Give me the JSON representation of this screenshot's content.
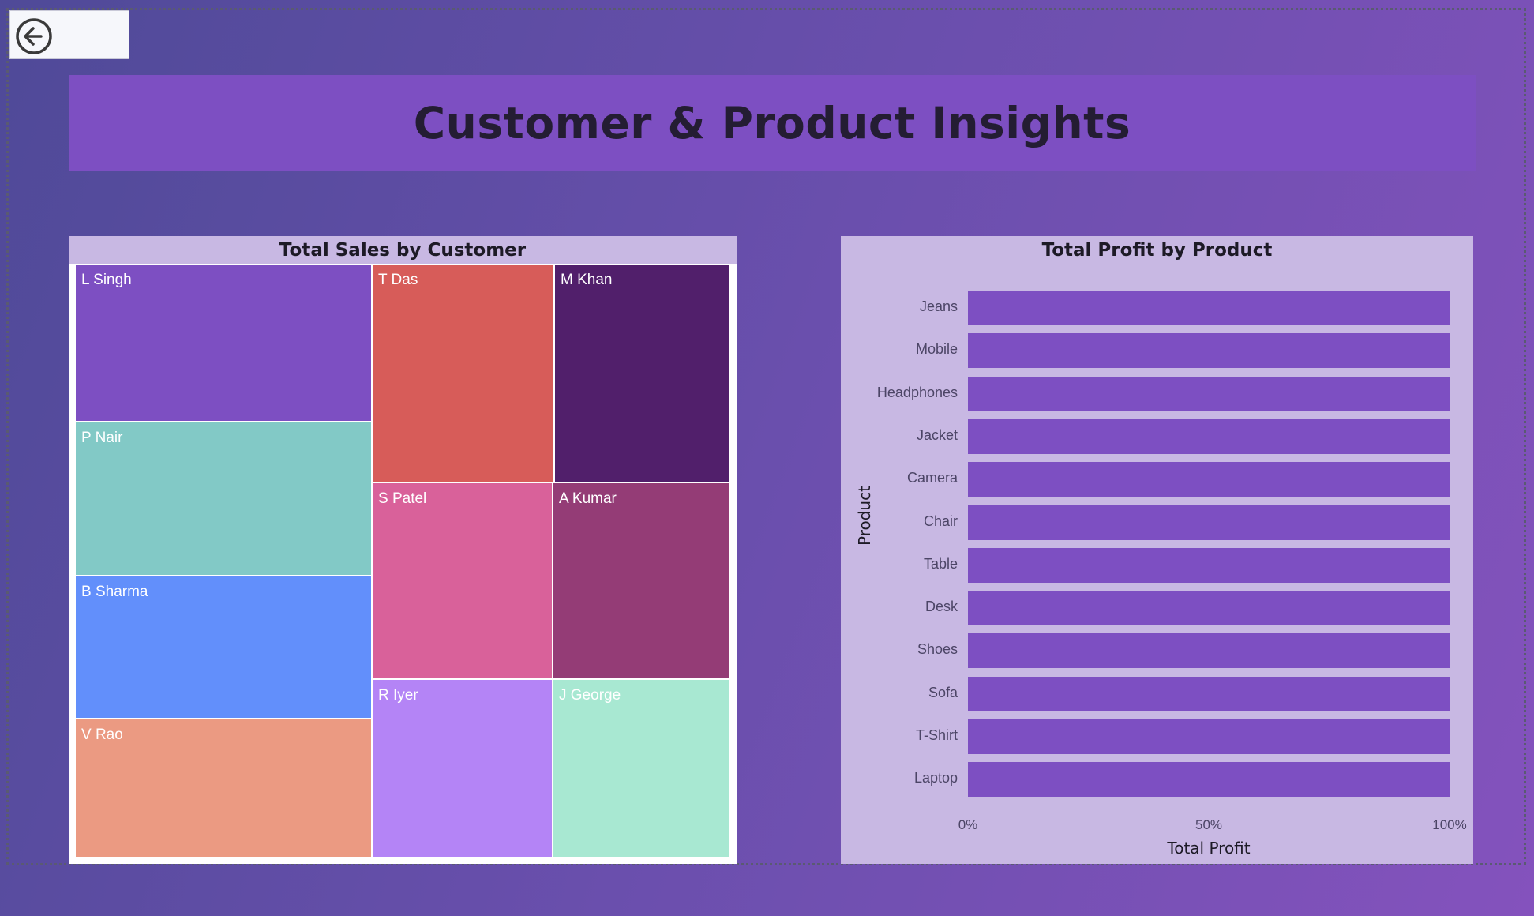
{
  "page": {
    "title": "Customer & Product Insights",
    "back_icon": "arrow-left-circle-icon"
  },
  "treemap": {
    "title": "Total Sales by Customer",
    "tiles": [
      {
        "label": "L Singh",
        "color": "#7d4fc2"
      },
      {
        "label": "P Nair",
        "color": "#82c9c6"
      },
      {
        "label": "B Sharma",
        "color": "#628ffb"
      },
      {
        "label": "V Rao",
        "color": "#eb9a82"
      },
      {
        "label": "T Das",
        "color": "#d75c59"
      },
      {
        "label": "M Khan",
        "color": "#511f6b"
      },
      {
        "label": "S Patel",
        "color": "#d9619a"
      },
      {
        "label": "A Kumar",
        "color": "#943c76"
      },
      {
        "label": "R Iyer",
        "color": "#b484f6"
      },
      {
        "label": "J George",
        "color": "#a8e8d2"
      }
    ]
  },
  "chart_data": {
    "type": "bar",
    "orientation": "horizontal",
    "title": "Total Profit by Product",
    "xlabel": "Total Profit",
    "ylabel": "Product",
    "categories": [
      "Jeans",
      "Mobile",
      "Headphones",
      "Jacket",
      "Camera",
      "Chair",
      "Table",
      "Desk",
      "Shoes",
      "Sofa",
      "T-Shirt",
      "Laptop"
    ],
    "values": [
      100,
      100,
      100,
      100,
      100,
      100,
      100,
      100,
      100,
      100,
      100,
      100
    ],
    "xticks": [
      "0%",
      "50%",
      "100%"
    ],
    "xlim": [
      0,
      100
    ],
    "bar_color": "#7d4fc2",
    "grid": false
  }
}
